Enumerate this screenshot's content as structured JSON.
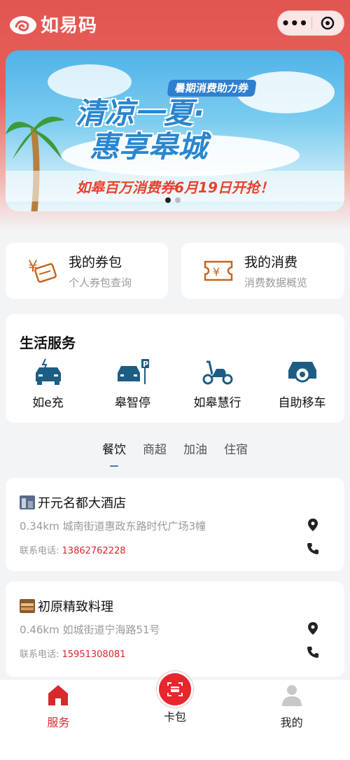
{
  "header": {
    "app_name": "如易码",
    "logo_icon": "cloud-swirl-logo-icon",
    "capsule": {
      "more_icon": "more-dots-icon",
      "close_icon": "target-circle-icon"
    }
  },
  "banner": {
    "tag": "暑期消费助力券",
    "headline_line1": "清凉一夏·",
    "headline_line2": "惠享皋城",
    "subline": "如皋百万消费券6月19日开抢！",
    "page_count": 2,
    "active_page": 1
  },
  "quick_actions": [
    {
      "title": "我的券包",
      "subtitle": "个人券包查询",
      "icon": "coupon-wallet-icon"
    },
    {
      "title": "我的消费",
      "subtitle": "消费数据概览",
      "icon": "consumption-ticket-icon"
    }
  ],
  "life_services": {
    "title": "生活服务",
    "items": [
      {
        "label": "如e充",
        "icon": "ev-charging-car-icon"
      },
      {
        "label": "皋智停",
        "icon": "parking-car-icon"
      },
      {
        "label": "如皋慧行",
        "icon": "scooter-icon"
      },
      {
        "label": "自助移车",
        "icon": "car-move-icon"
      }
    ]
  },
  "category_tabs": [
    {
      "label": "餐饮",
      "active": true
    },
    {
      "label": "商超",
      "active": false
    },
    {
      "label": "加油",
      "active": false
    },
    {
      "label": "住宿",
      "active": false
    }
  ],
  "stores": [
    {
      "name": "开元名都大酒店",
      "address": "0.34km 城南街道惠政东路时代广场3幢",
      "phone_label": "联系电话:",
      "phone": "13862762228"
    },
    {
      "name": "初原精致料理",
      "address": "0.46km 如城街道宁海路51号",
      "phone_label": "联系电话:",
      "phone": "15951308081"
    }
  ],
  "tabbar": [
    {
      "label": "服务",
      "icon": "home-icon",
      "active": true
    },
    {
      "label": "卡包",
      "icon": "card-wallet-icon",
      "active": false
    },
    {
      "label": "我的",
      "icon": "user-profile-icon",
      "active": false
    }
  ],
  "colors": {
    "brand_red": "#e25550",
    "accent_blue": "#2f7fd0",
    "phone_red": "#d8262e"
  }
}
